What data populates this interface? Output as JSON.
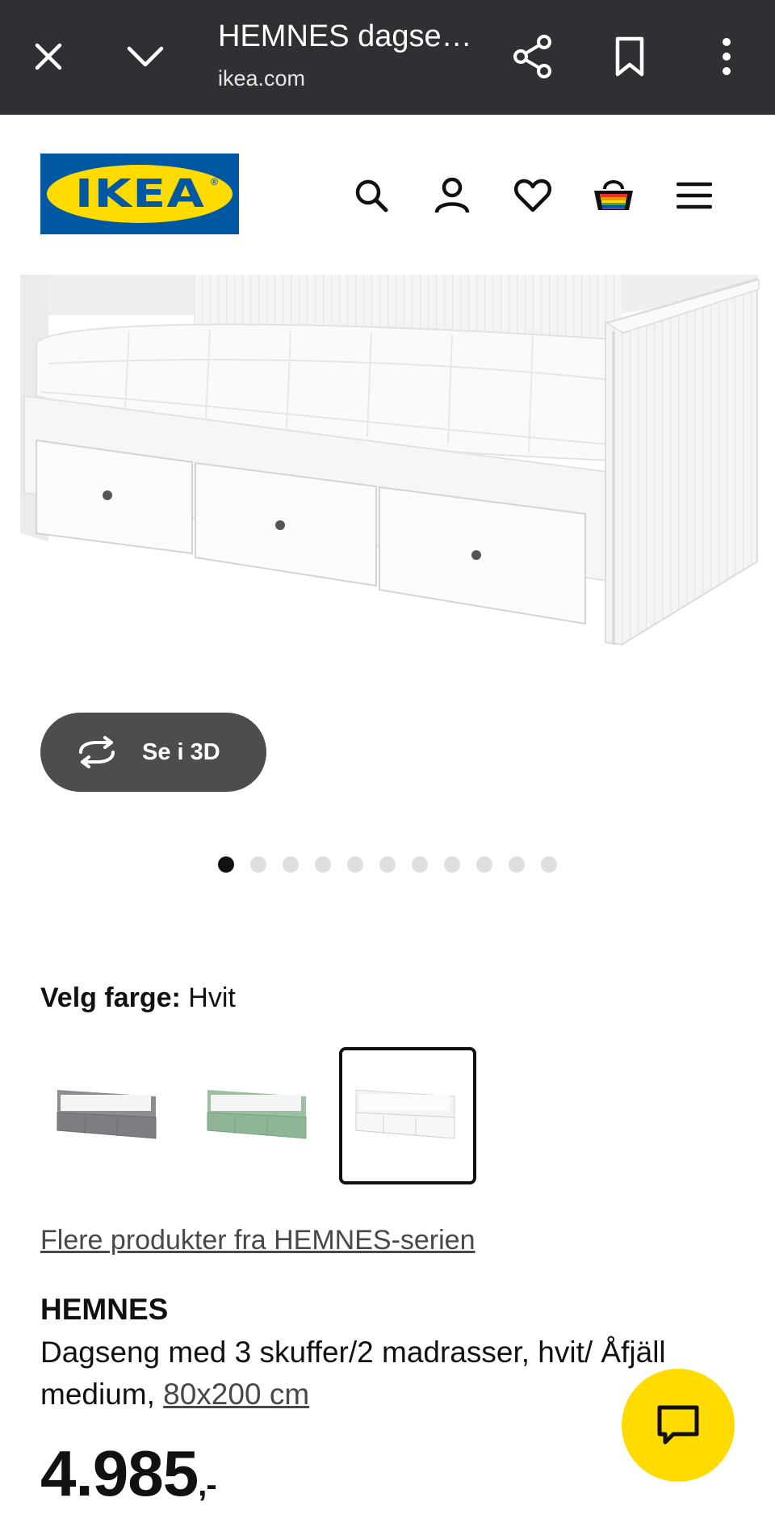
{
  "browser": {
    "title": "HEMNES dagse…",
    "url": "ikea.com",
    "icons": [
      "close-icon",
      "chevron-down-icon",
      "share-icon",
      "bookmark-icon",
      "more-vertical-icon"
    ]
  },
  "header": {
    "logo_text": "IKEA",
    "logo_reg": "®",
    "icons": [
      "search-icon",
      "user-icon",
      "heart-icon",
      "cart-icon",
      "menu-icon"
    ]
  },
  "gallery": {
    "view3d_label": "Se i 3D",
    "dot_count": 11,
    "active_dot": 0
  },
  "color": {
    "label": "Velg farge:",
    "selected_value": "Hvit",
    "options": [
      {
        "name": "grey",
        "color": "#8c8d90"
      },
      {
        "name": "green",
        "color": "#9bbfa0"
      },
      {
        "name": "white",
        "color": "#f4f4f4",
        "selected": true
      }
    ]
  },
  "series_link": "Flere produkter fra HEMNES-serien",
  "product": {
    "name": "HEMNES",
    "description": "Dagseng med 3 skuffer/2 madrasser, hvit/ Åfjäll medium, ",
    "size": "80x200 cm",
    "price": "4.985",
    "price_suffix": ",-"
  },
  "colors": {
    "topbar": "#2f3034",
    "ikea_blue": "#0058a3",
    "ikea_yellow": "#ffdb00",
    "button_dark": "#4d4d4d"
  }
}
